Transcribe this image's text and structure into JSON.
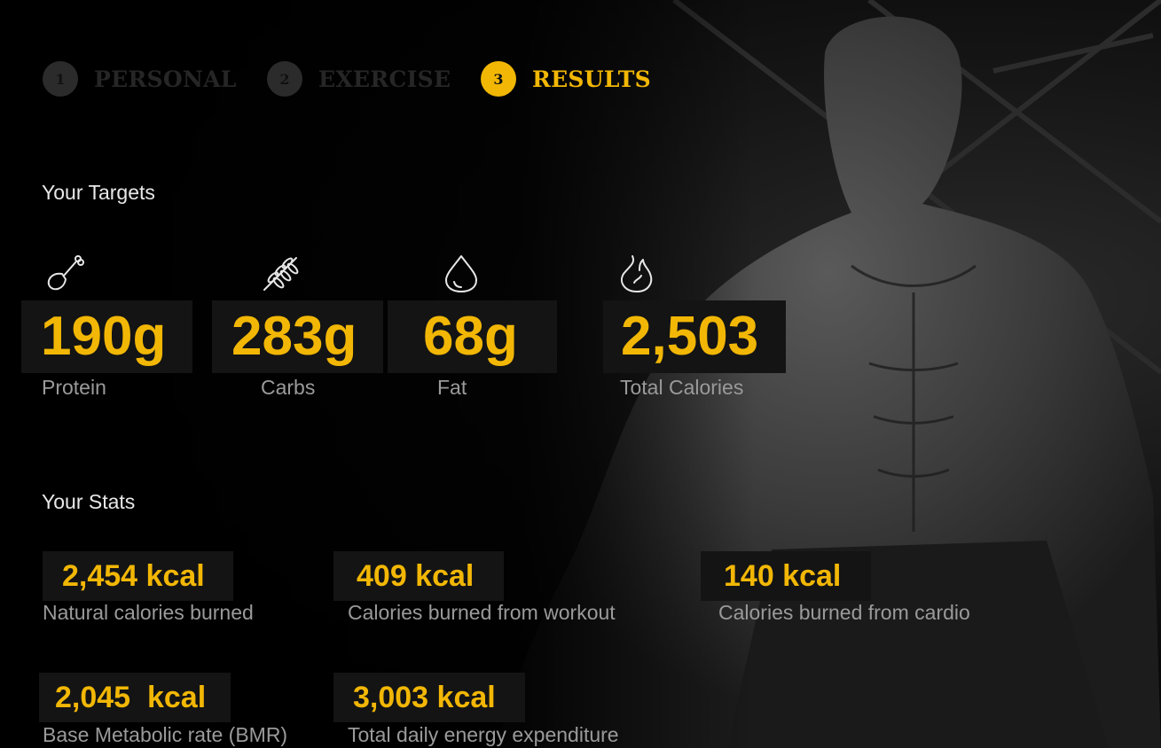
{
  "colors": {
    "accent": "#f2b705",
    "inactive_step": "#262626",
    "label": "#9a9a9a",
    "heading": "#e8e8e8"
  },
  "steps": [
    {
      "number": "1",
      "label": "PERSONAL",
      "active": false
    },
    {
      "number": "2",
      "label": "EXERCISE",
      "active": false
    },
    {
      "number": "3",
      "label": "RESULTS",
      "active": true
    }
  ],
  "targets": {
    "heading": "Your Targets",
    "items": [
      {
        "icon": "chicken-leg-icon",
        "value": "190g",
        "label": "Protein"
      },
      {
        "icon": "wheat-icon",
        "value": "283g",
        "label": "Carbs"
      },
      {
        "icon": "drop-icon",
        "value": "68g",
        "label": "Fat"
      },
      {
        "icon": "flame-icon",
        "value": "2,503",
        "label": "Total Calories"
      }
    ]
  },
  "stats": {
    "heading": "Your Stats",
    "items": [
      {
        "value": "2,454 kcal",
        "label": "Natural calories burned"
      },
      {
        "value": "409 kcal",
        "label": "Calories burned from workout"
      },
      {
        "value": "140 kcal",
        "label": "Calories burned from cardio"
      },
      {
        "value": "2,045  kcal",
        "label": "Base Metabolic rate (BMR)"
      },
      {
        "value": "3,003 kcal",
        "label": "Total daily energy expenditure"
      }
    ]
  }
}
